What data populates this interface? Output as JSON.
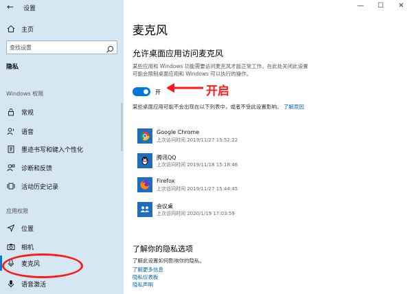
{
  "window": {
    "title": "设置",
    "back_glyph": "←",
    "minimize": "—",
    "maximize": "☐",
    "close": "✕"
  },
  "sidebar": {
    "home": "主页",
    "search_placeholder": "查找设置",
    "current_section": "隐私",
    "group_windows": "Windows 权限",
    "windows_items": [
      "常规",
      "语音",
      "墨迹书写和键入个性化",
      "诊断和反馈",
      "活动历史记录"
    ],
    "group_apps": "应用权限",
    "app_items": [
      "位置",
      "相机",
      "麦克风",
      "语音激活"
    ],
    "selected_item": "麦克风"
  },
  "main": {
    "page_title": "麦克风",
    "section_title": "允许桌面应用访问麦克风",
    "description": "某些应用和 Windows 功能需要访问麦克风才能正常工作。在此处关闭此设置可能会限制桌面应用和 Windows 可以执行的操作。",
    "toggle_state": "开",
    "toggle_on": true,
    "note_text": "某些桌面应用可能不会出现在以下列表中，或者不受此设置影响。",
    "note_link": "了解原因",
    "apps": [
      {
        "name": "Google Chrome",
        "last_access": "上次访问时间 2019/11/27 15:52:22",
        "icon": "chrome-icon"
      },
      {
        "name": "腾讯QQ",
        "last_access": "上次访问时间 2019/11/18 15:18:46",
        "icon": "qq-icon"
      },
      {
        "name": "Firefox",
        "last_access": "上次访问时间 2019/11/27 15:44:45",
        "icon": "firefox-icon"
      },
      {
        "name": "会议桌",
        "last_access": "上次访问时间 2020/1/19 17:03:59",
        "icon": "meeting-icon"
      }
    ],
    "privacy_title": "了解你的隐私选项",
    "privacy_desc": "了解此设置如何影响你的隐私。",
    "links": [
      "了解更多信息",
      "隐私仪表板",
      "隐私声明"
    ]
  },
  "annotation": {
    "text": "开启",
    "color": "#ff1a1a"
  },
  "colors": {
    "sidebar_bg": "#d6e7f4",
    "accent": "#0078d7",
    "link": "#0066b4"
  }
}
